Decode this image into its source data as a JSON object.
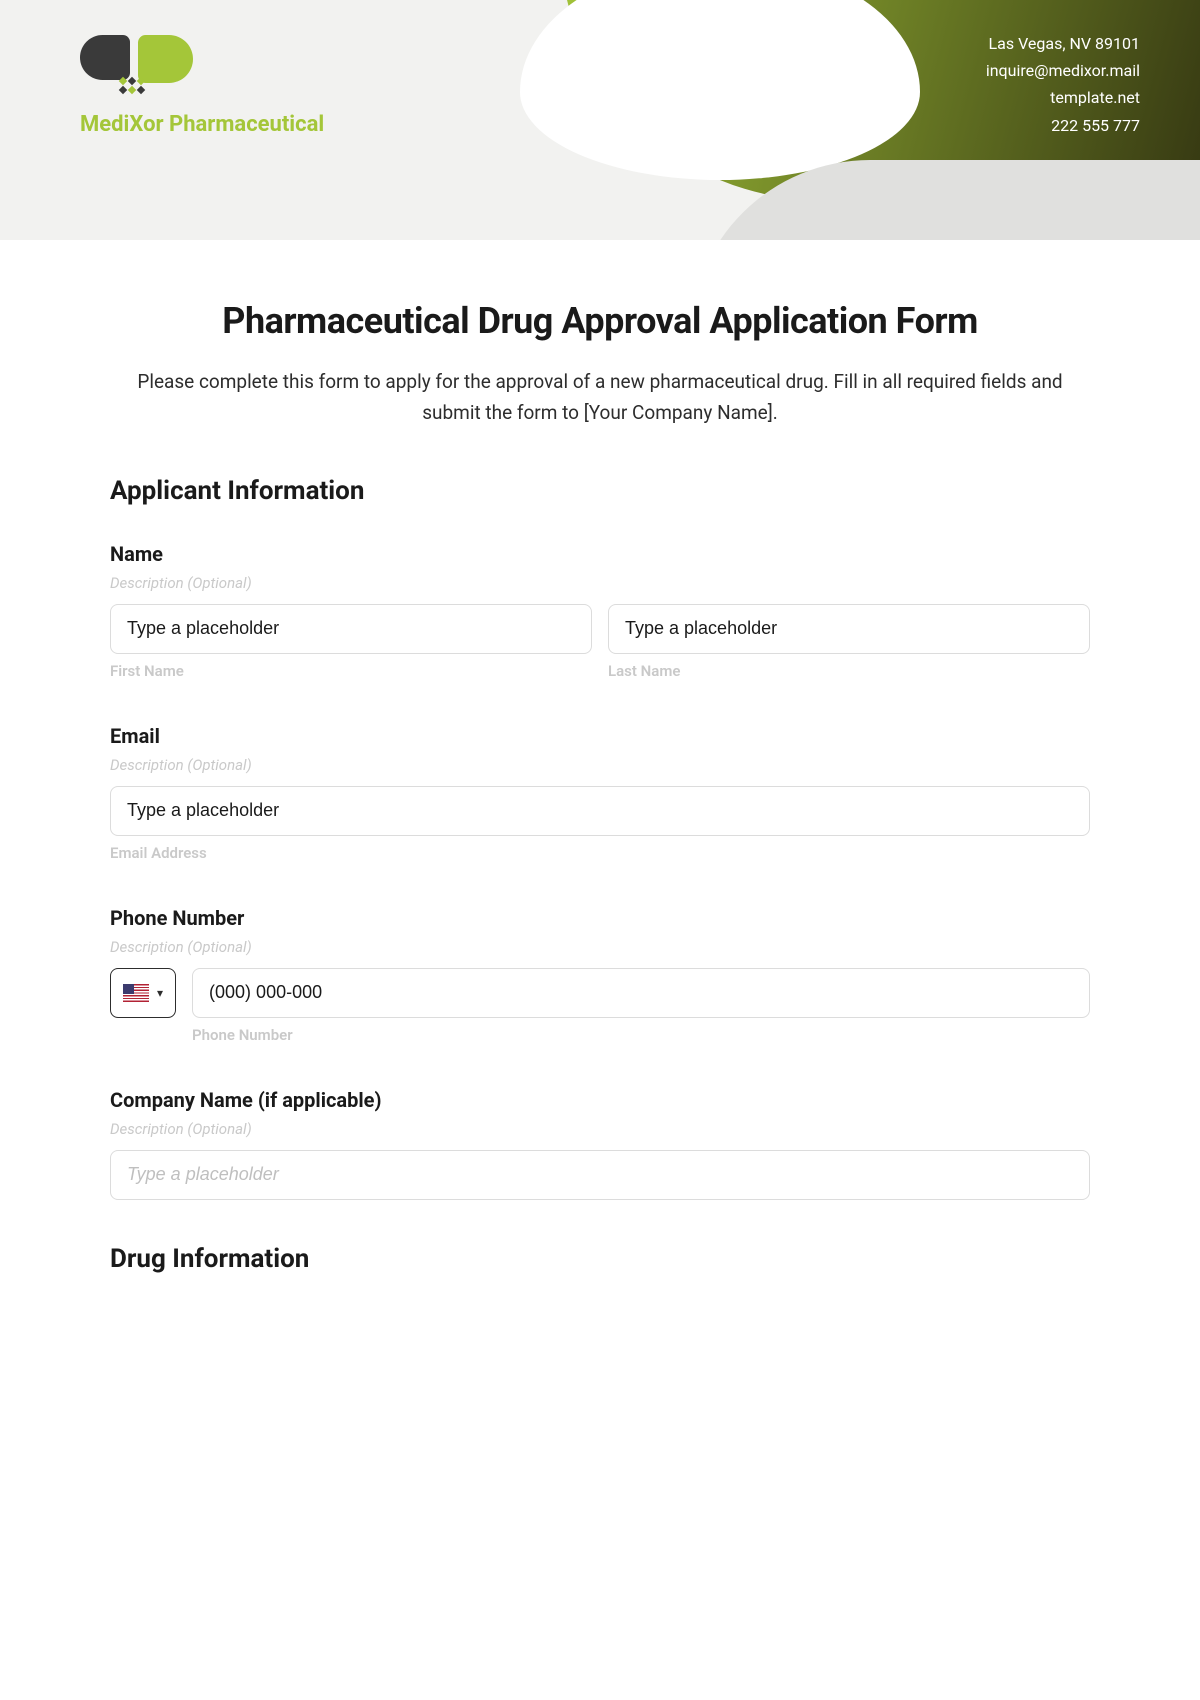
{
  "header": {
    "company_name": "MediXor Pharmaceutical",
    "contact": {
      "address": "Las Vegas, NV 89101",
      "email": "inquire@medixor.mail",
      "website": "template.net",
      "phone": "222 555 777"
    }
  },
  "form": {
    "title": "Pharmaceutical Drug Approval Application Form",
    "intro": "Please complete this form to apply for the approval of a new pharmaceutical drug. Fill in all required fields and submit the form to [Your Company Name].",
    "sections": {
      "applicant": {
        "heading": "Applicant Information",
        "fields": {
          "name": {
            "label": "Name",
            "description": "Description (Optional)",
            "first_placeholder": "Type a placeholder",
            "first_sublabel": "First Name",
            "last_placeholder": "Type a placeholder",
            "last_sublabel": "Last Name"
          },
          "email": {
            "label": "Email",
            "description": "Description (Optional)",
            "placeholder": "Type a placeholder",
            "sublabel": "Email Address"
          },
          "phone": {
            "label": "Phone Number",
            "description": "Description (Optional)",
            "placeholder": "(000) 000-000",
            "sublabel": "Phone Number"
          },
          "company": {
            "label": "Company Name (if applicable)",
            "description": "Description (Optional)",
            "placeholder": "Type a placeholder"
          }
        }
      },
      "drug": {
        "heading": "Drug Information"
      }
    }
  }
}
